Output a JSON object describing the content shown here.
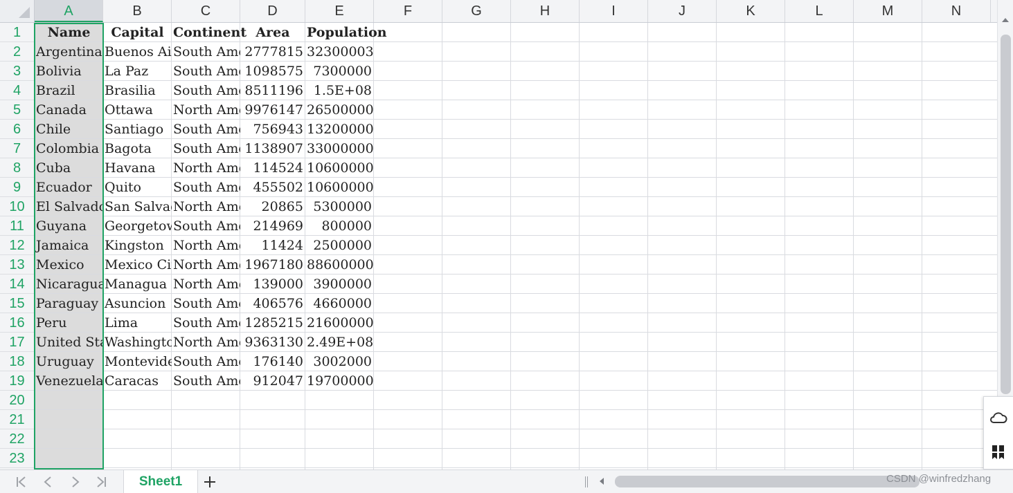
{
  "columns": [
    "A",
    "B",
    "C",
    "D",
    "E",
    "F",
    "G",
    "H",
    "I",
    "J",
    "K",
    "L",
    "M",
    "N"
  ],
  "rows": [
    "1",
    "2",
    "3",
    "4",
    "5",
    "6",
    "7",
    "8",
    "9",
    "10",
    "11",
    "12",
    "13",
    "14",
    "15",
    "16",
    "17",
    "18",
    "19",
    "20",
    "21",
    "22",
    "23"
  ],
  "selected_column": "A",
  "table": {
    "headers": [
      "Name",
      "Capital",
      "Continent",
      "Area",
      "Population"
    ],
    "rows": [
      [
        "Argentina",
        "Buenos Aires",
        "South America",
        "2777815",
        "32300003"
      ],
      [
        "Bolivia",
        "La Paz",
        "South America",
        "1098575",
        "7300000"
      ],
      [
        "Brazil",
        "Brasilia",
        "South America",
        "8511196",
        "1.5E+08"
      ],
      [
        "Canada",
        "Ottawa",
        "North America",
        "9976147",
        "26500000"
      ],
      [
        "Chile",
        "Santiago",
        "South America",
        "756943",
        "13200000"
      ],
      [
        "Colombia",
        "Bagota",
        "South America",
        "1138907",
        "33000000"
      ],
      [
        "Cuba",
        "Havana",
        "North America",
        "114524",
        "10600000"
      ],
      [
        "Ecuador",
        "Quito",
        "South America",
        "455502",
        "10600000"
      ],
      [
        "El Salvador",
        "San Salvador",
        "North America",
        "20865",
        "5300000"
      ],
      [
        "Guyana",
        "Georgetown",
        "South America",
        "214969",
        "800000"
      ],
      [
        "Jamaica",
        "Kingston",
        "North America",
        "11424",
        "2500000"
      ],
      [
        "Mexico",
        "Mexico City",
        "North America",
        "1967180",
        "88600000"
      ],
      [
        "Nicaragua",
        "Managua",
        "North America",
        "139000",
        "3900000"
      ],
      [
        "Paraguay",
        "Asuncion",
        "South America",
        "406576",
        "4660000"
      ],
      [
        "Peru",
        "Lima",
        "South America",
        "1285215",
        "21600000"
      ],
      [
        "United States",
        "Washington",
        "North America",
        "9363130",
        "2.49E+08"
      ],
      [
        "Uruguay",
        "Montevideo",
        "South America",
        "176140",
        "3002000"
      ],
      [
        "Venezuela",
        "Caracas",
        "South America",
        "912047",
        "19700000"
      ]
    ]
  },
  "tabs": {
    "sheet_label": "Sheet1"
  },
  "watermark": "CSDN @winfredzhang",
  "colors": {
    "accent": "#1fa364",
    "selected_column_bg": "#dcdcdc"
  }
}
